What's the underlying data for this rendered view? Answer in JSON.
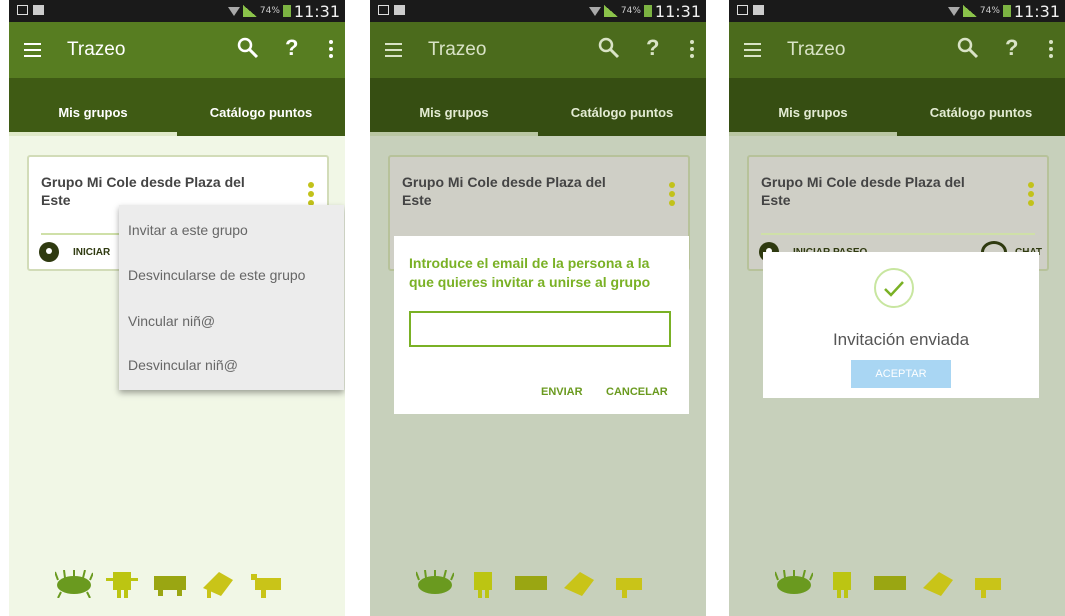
{
  "status": {
    "battery": "74%",
    "time": "11:31"
  },
  "toolbar": {
    "title": "Trazeo"
  },
  "tabs": [
    "Mis grupos",
    "Catálogo puntos"
  ],
  "card": {
    "title": "Grupo Mi Cole desde Plaza del Este",
    "action": "INICIAR PASEO",
    "chat": "CHAT",
    "action_partial": "INICIAR"
  },
  "menu": {
    "items": [
      "Invitar a este grupo",
      "Desvincularse de este grupo",
      "Vincular niñ@",
      "Desvincular niñ@"
    ]
  },
  "invite_dialog": {
    "message": "Introduce el email de la persona a la que quieres invitar a unirse al grupo",
    "input_value": "",
    "send": "ENVIAR",
    "cancel": "CANCELAR"
  },
  "success_dialog": {
    "message": "Invitación enviada",
    "button": "ACEPTAR"
  },
  "colors": {
    "toolbar": "#577d21",
    "tabbar": "#3f5b14",
    "accent": "#7ab125"
  }
}
